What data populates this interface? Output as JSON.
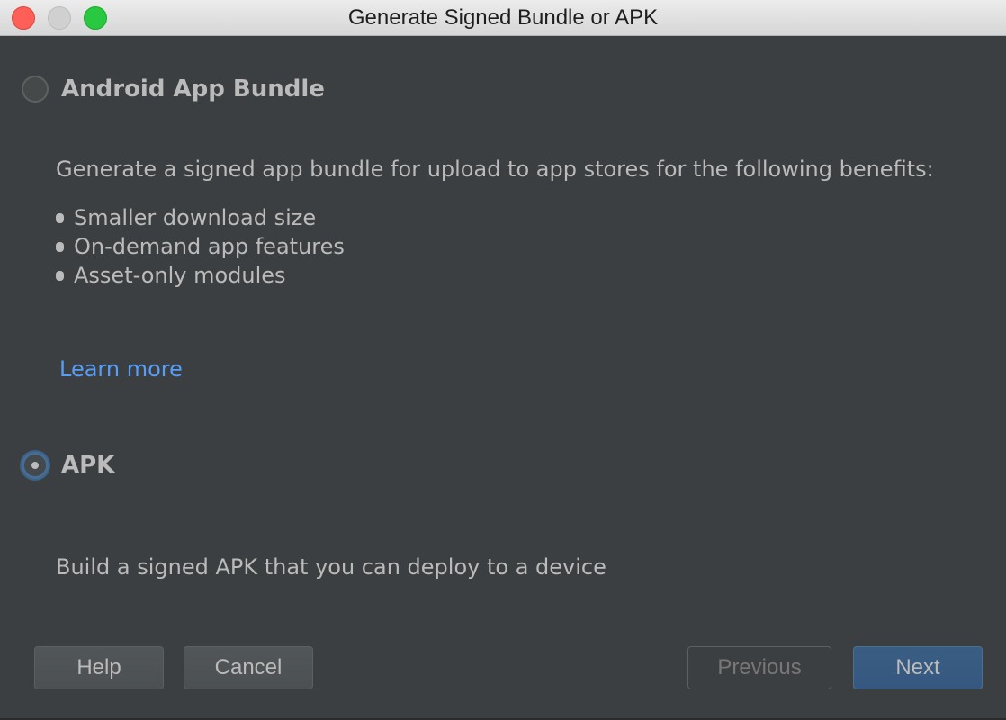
{
  "window": {
    "title": "Generate Signed Bundle or APK"
  },
  "options": {
    "bundle": {
      "label": "Android App Bundle",
      "selected": false,
      "description": "Generate a signed app bundle for upload to app stores for the following benefits:",
      "benefits": [
        "Smaller download size",
        "On-demand app features",
        "Asset-only modules"
      ],
      "learn_more": "Learn more"
    },
    "apk": {
      "label": "APK",
      "selected": true,
      "description": "Build a signed APK that you can deploy to a device"
    }
  },
  "buttons": {
    "help": "Help",
    "cancel": "Cancel",
    "previous": "Previous",
    "next": "Next"
  },
  "colors": {
    "background": "#3c3f41",
    "text": "#bbbbbb",
    "link": "#589df6",
    "primary_button": "#365880",
    "focus_ring": "#466d94"
  }
}
